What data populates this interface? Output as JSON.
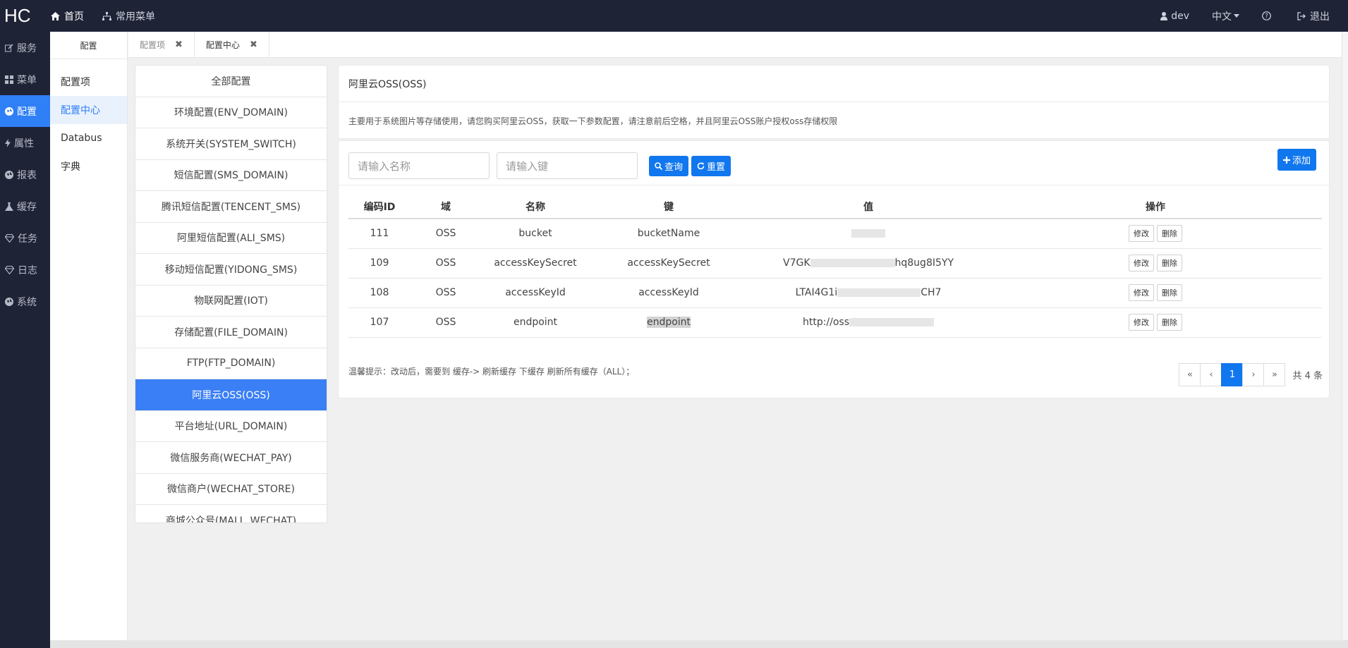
{
  "topbar": {
    "logo": "HC",
    "nav": [
      {
        "label": "首页",
        "icon": "home-icon"
      },
      {
        "label": "常用菜单",
        "icon": "sitemap-icon"
      }
    ],
    "user": "dev",
    "language": "中文",
    "logout": "退出"
  },
  "sidebar": {
    "items": [
      {
        "label": "服务",
        "icon": "edit-icon"
      },
      {
        "label": "菜单",
        "icon": "grid-icon"
      },
      {
        "label": "配置",
        "icon": "globe-icon"
      },
      {
        "label": "属性",
        "icon": "bolt-icon"
      },
      {
        "label": "报表",
        "icon": "globe-icon"
      },
      {
        "label": "缓存",
        "icon": "flask-icon"
      },
      {
        "label": "任务",
        "icon": "diamond-icon"
      },
      {
        "label": "日志",
        "icon": "diamond-icon"
      },
      {
        "label": "系统",
        "icon": "globe-icon"
      }
    ],
    "active_index": 2
  },
  "subsidebar": {
    "header": "配置",
    "items": [
      "配置项",
      "配置中心",
      "Databus",
      "字典"
    ],
    "active_index": 1
  },
  "tabs": [
    {
      "label": "配置项"
    },
    {
      "label": "配置中心"
    }
  ],
  "categories": {
    "items": [
      "全部配置",
      "环境配置(ENV_DOMAIN)",
      "系统开关(SYSTEM_SWITCH)",
      "短信配置(SMS_DOMAIN)",
      "腾讯短信配置(TENCENT_SMS)",
      "阿里短信配置(ALI_SMS)",
      "移动短信配置(YIDONG_SMS)",
      "物联网配置(IOT)",
      "存储配置(FILE_DOMAIN)",
      "FTP(FTP_DOMAIN)",
      "阿里云OSS(OSS)",
      "平台地址(URL_DOMAIN)",
      "微信服务商(WECHAT_PAY)",
      "微信商户(WECHAT_STORE)",
      "商城公众号(MALL_WECHAT)"
    ],
    "active_index": 10
  },
  "info": {
    "title": "阿里云OSS(OSS)",
    "description": "主要用于系统图片等存储使用，请您购买阿里云OSS，获取一下参数配置，请注意前后空格，并且阿里云OSS账户授权oss存储权限"
  },
  "search": {
    "name_placeholder": "请输入名称",
    "key_placeholder": "请输入键",
    "query_label": "查询",
    "reset_label": "重置",
    "add_label": "添加"
  },
  "table": {
    "headers": [
      "编码ID",
      "域",
      "名称",
      "键",
      "值",
      "操作"
    ],
    "rows": [
      {
        "id": "111",
        "domain": "OSS",
        "name": "bucket",
        "key": "bucketName",
        "value_prefix": "",
        "value_suffix": ""
      },
      {
        "id": "109",
        "domain": "OSS",
        "name": "accessKeySecret",
        "key": "accessKeySecret",
        "value_prefix": "V7GK",
        "value_suffix": "hq8ug8I5YY"
      },
      {
        "id": "108",
        "domain": "OSS",
        "name": "accessKeyId",
        "key": "accessKeyId",
        "value_prefix": "LTAI4G1i",
        "value_suffix": "CH7"
      },
      {
        "id": "107",
        "domain": "OSS",
        "name": "endpoint",
        "key": "endpoint",
        "value_prefix": "http://oss",
        "value_suffix": ""
      }
    ],
    "edit_label": "修改",
    "delete_label": "删除"
  },
  "tips": "温馨提示：改动后，需要到 缓存-> 刷新缓存 下缓存 刷新所有缓存（ALL）；",
  "pager": {
    "first": "«",
    "prev": "‹",
    "current": "1",
    "next": "›",
    "last": "»",
    "total": "共 4 条"
  },
  "colors": {
    "topbar": "#1f2336",
    "accent": "#2f7ff7",
    "button": "#1177ee"
  }
}
